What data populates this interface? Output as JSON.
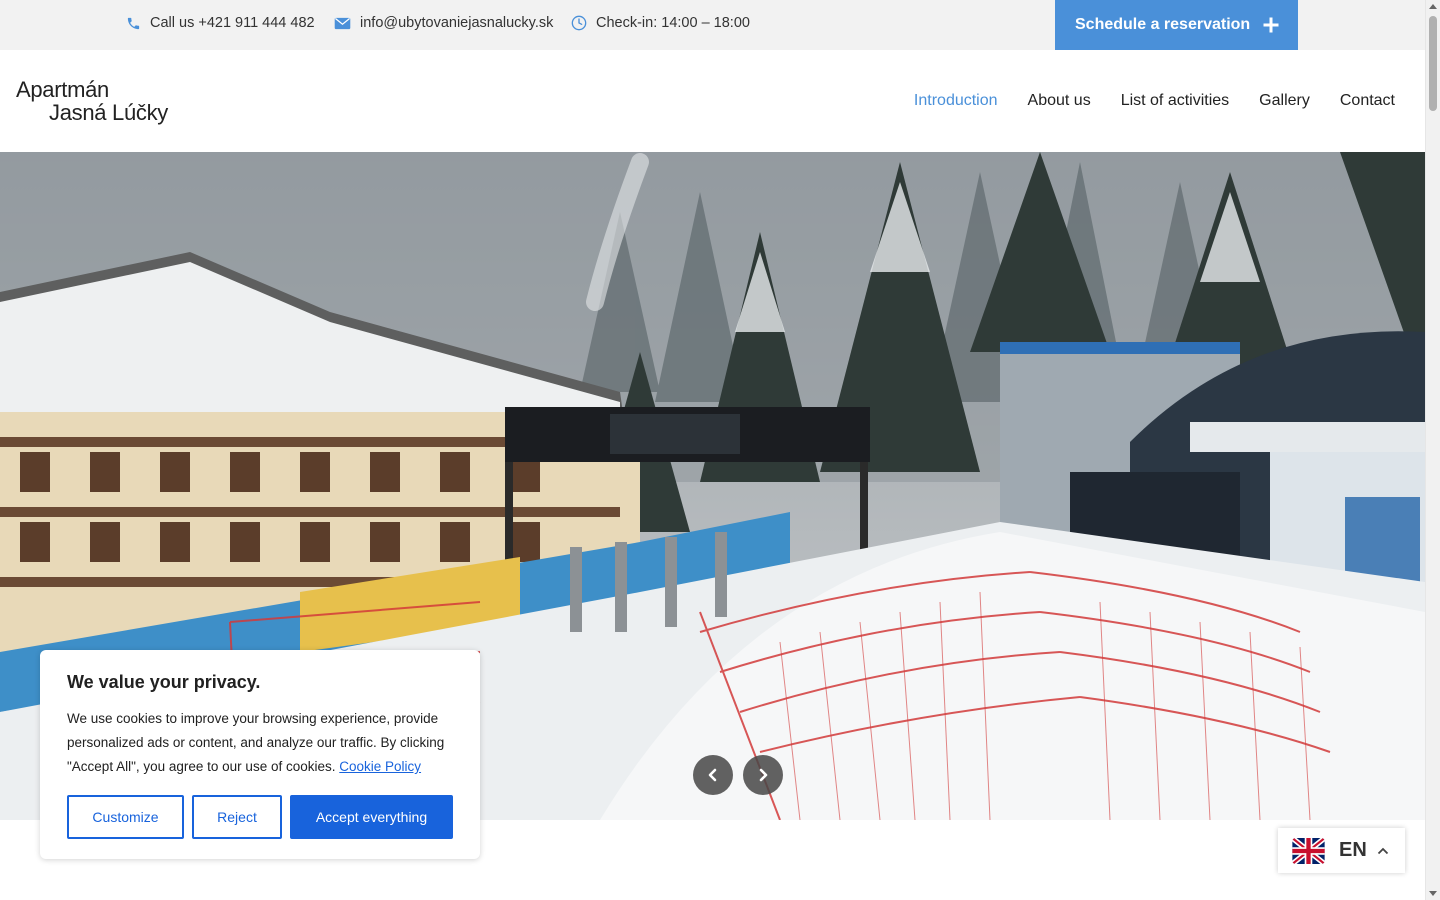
{
  "topbar": {
    "phone": "Call us +421 911 444 482",
    "email": "info@ubytovaniejasnalucky.sk",
    "checkin": "Check-in: 14:00 – 18:00",
    "reserve_label": "Schedule a reservation",
    "phone_icon": "phone-icon",
    "email_icon": "envelope-icon",
    "clock_icon": "clock-icon",
    "accent_color": "#4a90d9"
  },
  "header": {
    "logo_line1": "Apartmán",
    "logo_line2": "Jasná Lúčky"
  },
  "nav": {
    "items": [
      {
        "label": "Introduction",
        "active": true
      },
      {
        "label": "About us",
        "active": false
      },
      {
        "label": "List of activities",
        "active": false
      },
      {
        "label": "Gallery",
        "active": false
      },
      {
        "label": "Contact",
        "active": false
      }
    ]
  },
  "hero": {
    "prev_icon": "chevron-left-icon",
    "next_icon": "chevron-right-icon"
  },
  "cookie": {
    "title": "We value your privacy.",
    "text": "We use cookies to improve your browsing experience, provide personalized ads or content, and analyze our traffic. By clicking \"Accept All\", you agree to our use of cookies.",
    "policy_link": "Cookie Policy",
    "customize_label": "Customize",
    "reject_label": "Reject",
    "accept_label": "Accept everything",
    "button_color": "#1863dc"
  },
  "language": {
    "code": "EN",
    "flag_icon": "uk-flag-icon",
    "caret_icon": "chevron-up-icon"
  }
}
